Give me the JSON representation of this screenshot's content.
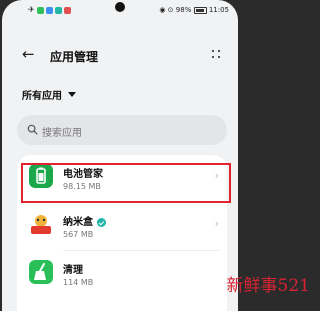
{
  "status_bar": {
    "time": "11:05",
    "battery": "98%",
    "indicators": [
      "airplane-icon",
      "app-notification-icons",
      "camera-cutout",
      "signal-icons",
      "battery-icon"
    ]
  },
  "header": {
    "title": "应用管理",
    "back_icon": "arrow-left",
    "more_icon": "more-dots"
  },
  "filter": {
    "label": "所有应用"
  },
  "search": {
    "placeholder": "搜索应用"
  },
  "apps": [
    {
      "name": "电池管家",
      "size": "98.15 MB",
      "icon": "battery-app-icon",
      "icon_color": "#1aa84a",
      "highlighted": true
    },
    {
      "name": "纳米盒",
      "size": "567 MB",
      "icon": "nanohe-app-icon",
      "icon_color": "#e23b2e",
      "verified": true
    },
    {
      "name": "清理",
      "size": "114 MB",
      "icon": "broom-app-icon",
      "icon_color": "#2bbf5a"
    }
  ],
  "watermark": "新鲜事521",
  "colors": {
    "highlight": "#e0232e",
    "background": "#f1f2f4"
  }
}
